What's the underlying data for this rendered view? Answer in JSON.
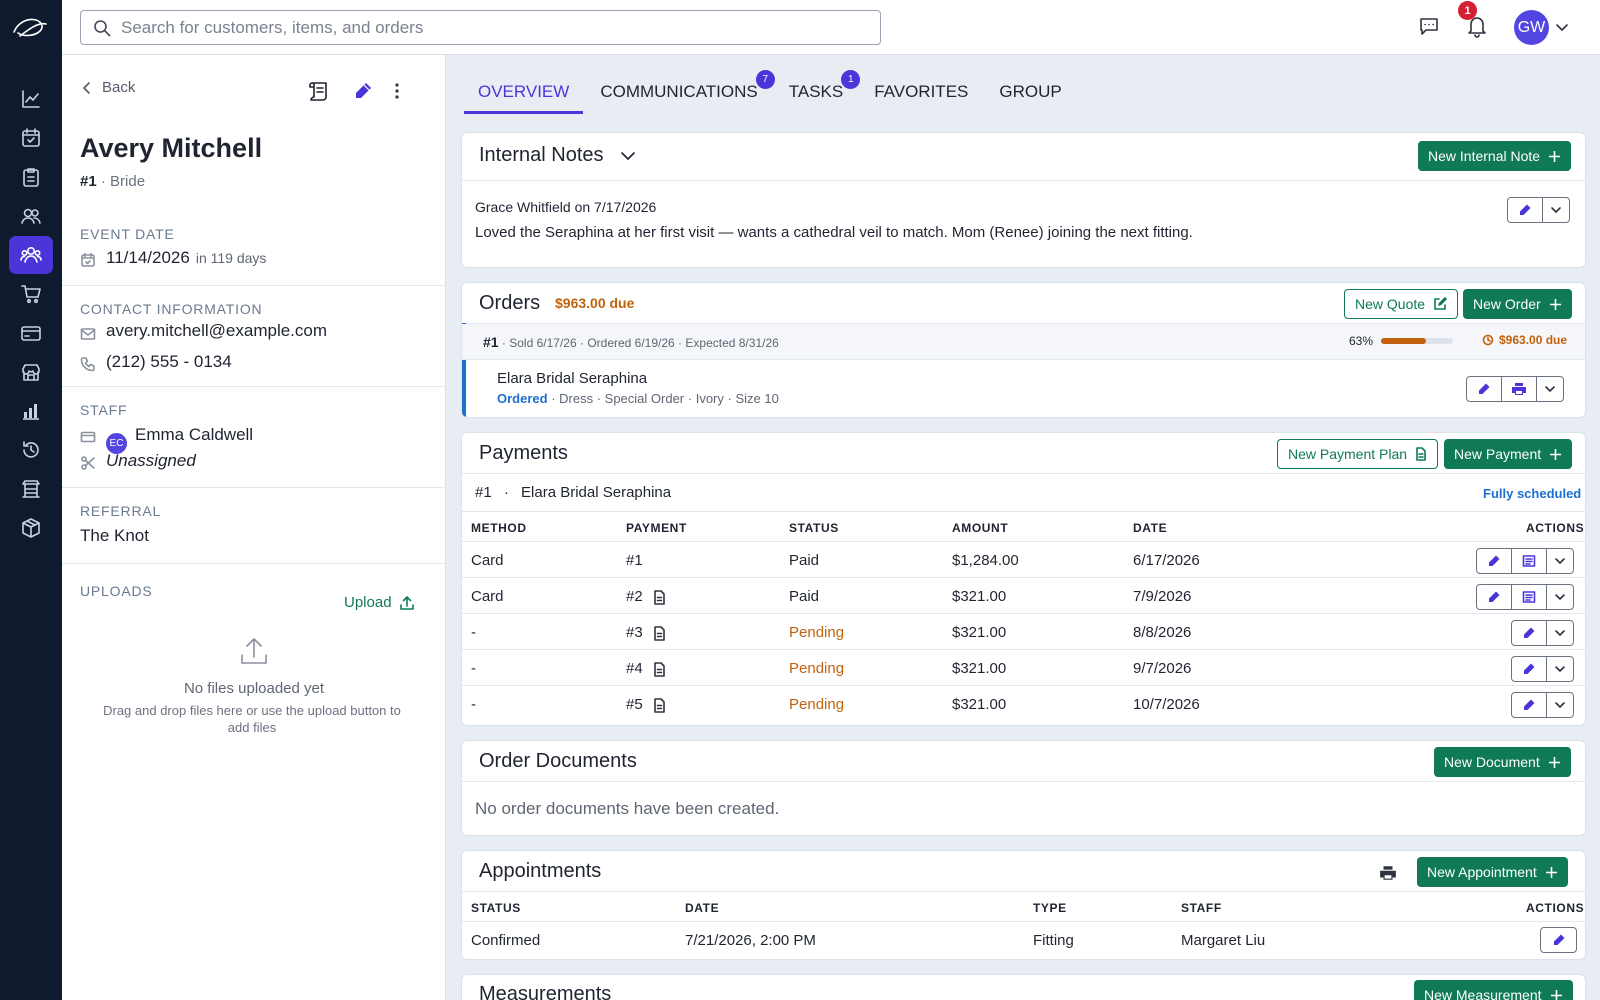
{
  "search": {
    "placeholder": "Search for customers, items, and orders"
  },
  "header": {
    "notification_count": "1",
    "avatar_initials": "GW"
  },
  "panel": {
    "back_label": "Back",
    "customer_name": "Avery Mitchell",
    "customer_number": "#1",
    "customer_role": "Bride",
    "event_date_title": "EVENT DATE",
    "event_date": "11/14/2026",
    "event_relative": "in 119 days",
    "contact_title": "CONTACT INFORMATION",
    "email": "avery.mitchell@example.com",
    "phone": "(212) 555 - 0134",
    "staff_title": "STAFF",
    "staff_initials": "EC",
    "staff_name": "Emma Caldwell",
    "staff_unassigned": "Unassigned",
    "referral_title": "REFERRAL",
    "referral": "The Knot",
    "uploads_title": "UPLOADS",
    "upload_label": "Upload",
    "no_files": "No files uploaded yet",
    "drag_text": "Drag and drop files here or use the upload button to add files"
  },
  "tabs": [
    {
      "label": "OVERVIEW",
      "badge": ""
    },
    {
      "label": "COMMUNICATIONS",
      "badge": "7"
    },
    {
      "label": "TASKS",
      "badge": "1"
    },
    {
      "label": "FAVORITES",
      "badge": ""
    },
    {
      "label": "GROUP",
      "badge": ""
    }
  ],
  "notes": {
    "title": "Internal Notes",
    "new_label": "New Internal Note",
    "author_line": "Grace Whitfield on 7/17/2026",
    "body": "Loved the Seraphina at her first visit — wants a cathedral veil to match. Mom (Renee) joining the next fitting."
  },
  "orders": {
    "title": "Orders",
    "due": "$963.00 due",
    "new_quote": "New Quote",
    "new_order": "New Order",
    "order_number": "#1",
    "sold": "Sold 6/17/26",
    "ordered": "Ordered 6/19/26",
    "expected": "Expected 8/31/26",
    "progress_label": "63%",
    "progress": 0.63,
    "order_due": "$963.00 due",
    "item_name": "Elara Bridal Seraphina",
    "item_status": "Ordered",
    "item_tags": [
      "Dress",
      "Special Order",
      "Ivory",
      "Size 10"
    ]
  },
  "payments": {
    "title": "Payments",
    "new_plan": "New Payment Plan",
    "new_payment": "New Payment",
    "plan_number": "#1",
    "plan_item": "Elara Bridal Seraphina",
    "plan_status": "Fully scheduled",
    "headers": [
      "METHOD",
      "PAYMENT",
      "STATUS",
      "AMOUNT",
      "DATE",
      "ACTIONS"
    ],
    "rows": [
      {
        "method": "Card",
        "payment": "#1",
        "status": "Paid",
        "amount": "$1,284.00",
        "date": "6/17/2026"
      },
      {
        "method": "Card",
        "payment": "#2",
        "status": "Paid",
        "amount": "$321.00",
        "date": "7/9/2026"
      },
      {
        "method": "-",
        "payment": "#3",
        "status": "Pending",
        "amount": "$321.00",
        "date": "8/8/2026"
      },
      {
        "method": "-",
        "payment": "#4",
        "status": "Pending",
        "amount": "$321.00",
        "date": "9/7/2026"
      },
      {
        "method": "-",
        "payment": "#5",
        "status": "Pending",
        "amount": "$321.00",
        "date": "10/7/2026"
      }
    ]
  },
  "documents": {
    "title": "Order Documents",
    "new_label": "New Document",
    "empty": "No order documents have been created."
  },
  "appointments": {
    "title": "Appointments",
    "new_label": "New Appointment",
    "headers": [
      "STATUS",
      "DATE",
      "TYPE",
      "STAFF",
      "ACTIONS"
    ],
    "rows": [
      {
        "status": "Confirmed",
        "date": "7/21/2026, 2:00 PM",
        "type": "Fitting",
        "staff": "Margaret Liu"
      }
    ]
  },
  "measurements": {
    "title": "Measurements",
    "new_label": "New Measurement"
  },
  "colors": {
    "primary": "#4a35d8",
    "green": "#0f7a55",
    "due": "#c2610c",
    "rail": "#0f1a2e"
  }
}
